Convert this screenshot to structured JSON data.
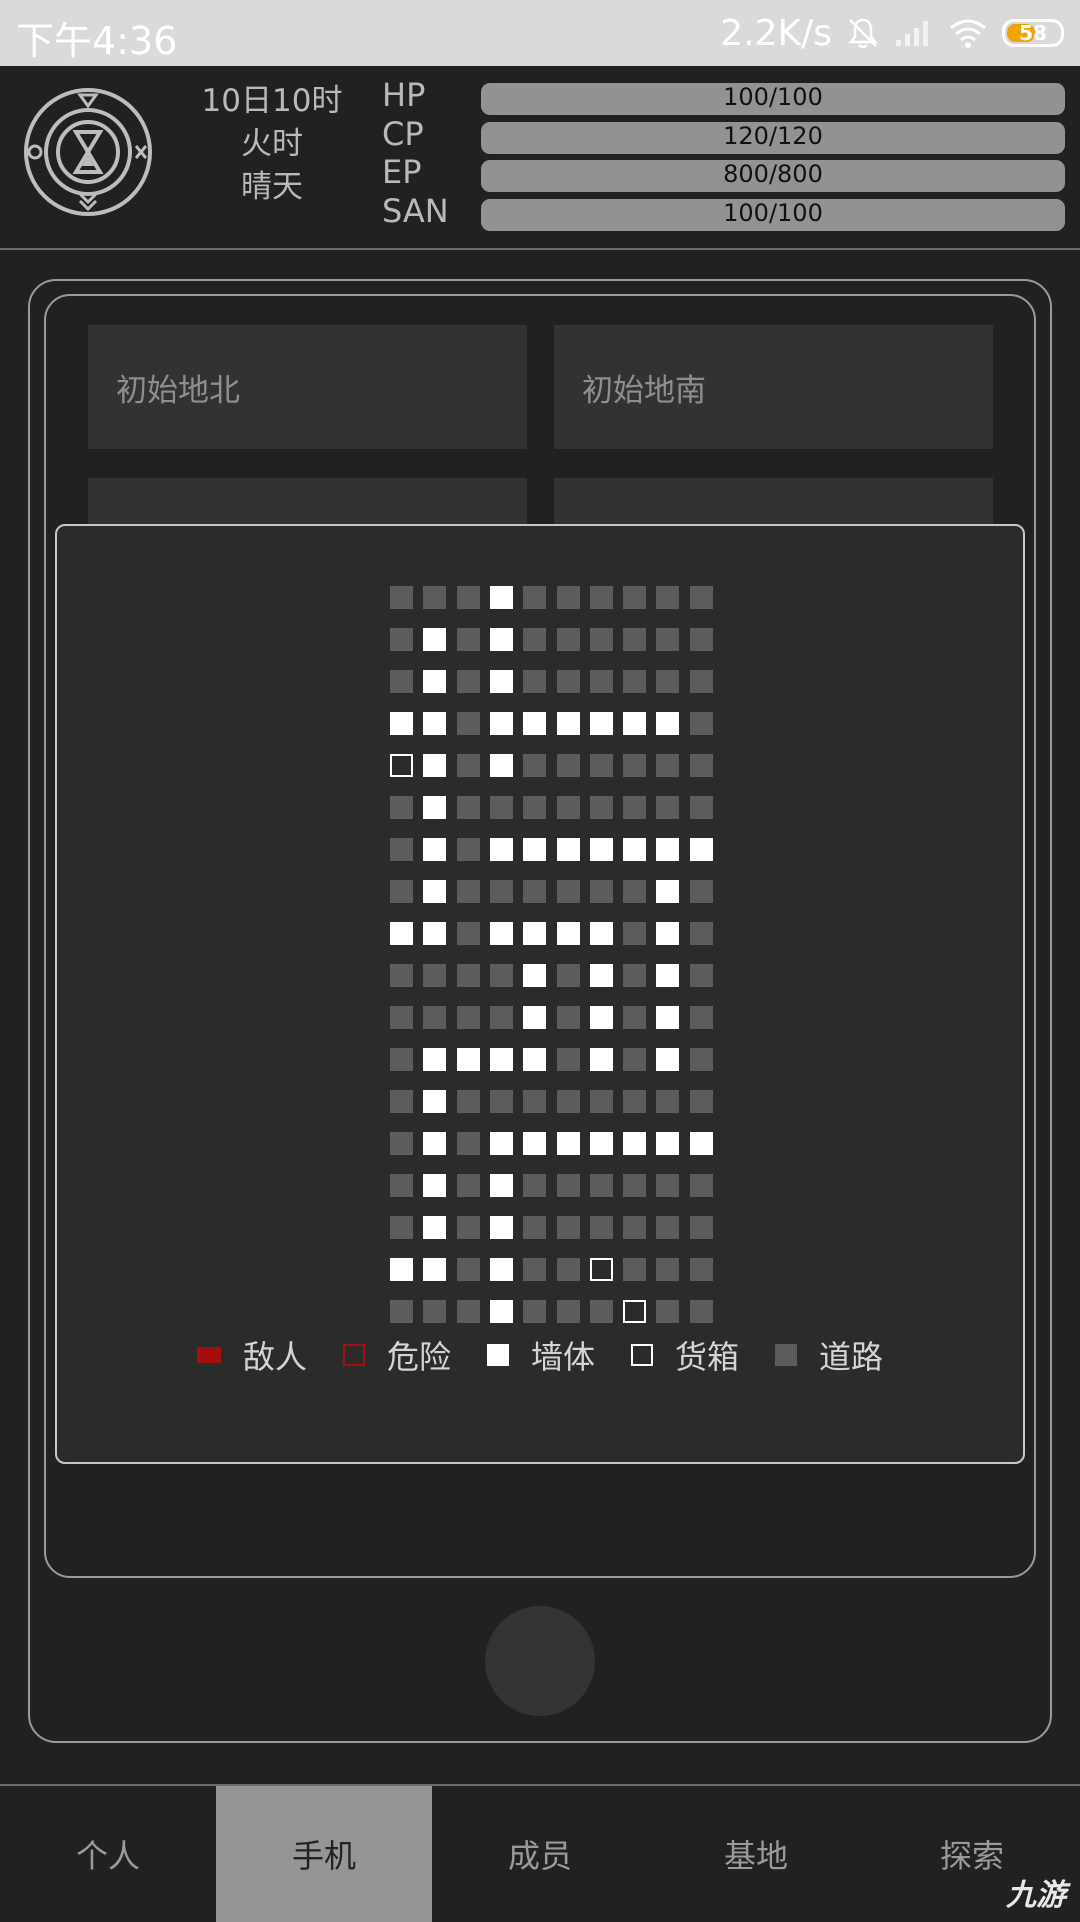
{
  "status_bar": {
    "time": "下午4:36",
    "net_speed": "2.2K/s",
    "battery": "58",
    "battery_level": 0.58,
    "icons": [
      "mute-bell-icon",
      "signal-icon",
      "wifi-icon",
      "battery-icon"
    ]
  },
  "header": {
    "date": "10日10时",
    "element_hour": "火时",
    "weather": "晴天",
    "stats": [
      {
        "label": "HP",
        "value": "100/100"
      },
      {
        "label": "CP",
        "value": "120/120"
      },
      {
        "label": "EP",
        "value": "800/800"
      },
      {
        "label": "SAN",
        "value": "100/100"
      }
    ]
  },
  "locations": [
    "初始地北",
    "初始地南"
  ],
  "map": {
    "rows": [
      "rrrwrrrrrr",
      "rwrwrrrrrr",
      "rwrwrrrrrr",
      "wwrwwwwwwr",
      "cwrwrrrrrr",
      "rwrrrrrrrr",
      "rwrwwwwwww",
      "rwrrrrrrwr",
      "wwrwwwwrwr",
      "rrrrwrwrwr",
      "rrrrwrwrwr",
      "rwwwwrwrwr",
      "rwrrrrrrrr",
      "rwrwwwwwww",
      "rwrwrrrrrr",
      "rwrwrrrrrr",
      "wwrwrrcrrr",
      "rrrwrrrcrr"
    ],
    "key": {
      "r": "road",
      "w": "wall",
      "c": "crate",
      "d": "danger",
      "e": "enemy"
    }
  },
  "legend": [
    {
      "type": "enemy",
      "label": "敌人"
    },
    {
      "type": "danger",
      "label": "危险"
    },
    {
      "type": "wall",
      "label": "墙体"
    },
    {
      "type": "crate",
      "label": "货箱"
    },
    {
      "type": "road",
      "label": "道路"
    }
  ],
  "tabs": [
    {
      "label": "个人",
      "active": false
    },
    {
      "label": "手机",
      "active": true
    },
    {
      "label": "成员",
      "active": false
    },
    {
      "label": "基地",
      "active": false
    },
    {
      "label": "探索",
      "active": false
    }
  ],
  "watermark": "九游",
  "colors": {
    "background": "#212121",
    "panel": "#2b2b2b",
    "wall": "#ffffff",
    "road": "#5c5c5c",
    "enemy": "#a50d0d",
    "battery": "#f0a400",
    "active_tab": "#959595"
  }
}
